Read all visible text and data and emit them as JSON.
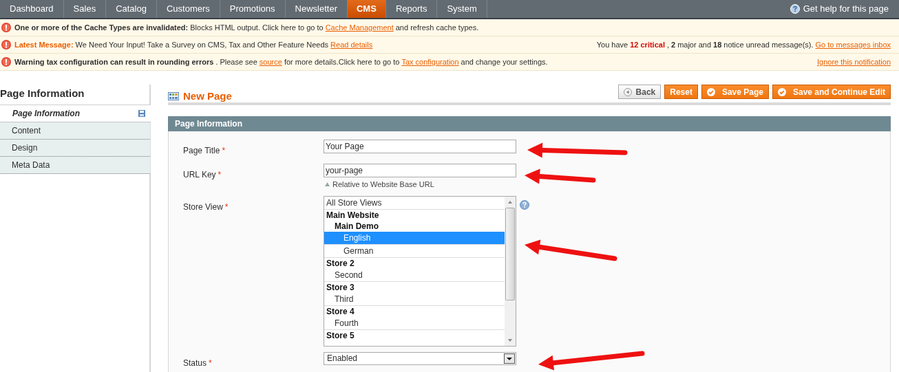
{
  "nav": {
    "items": [
      {
        "label": "Dashboard",
        "selected": false
      },
      {
        "label": "Sales",
        "selected": false
      },
      {
        "label": "Catalog",
        "selected": false
      },
      {
        "label": "Customers",
        "selected": false
      },
      {
        "label": "Promotions",
        "selected": false
      },
      {
        "label": "Newsletter",
        "selected": false
      },
      {
        "label": "CMS",
        "selected": true
      },
      {
        "label": "Reports",
        "selected": false
      },
      {
        "label": "System",
        "selected": false
      }
    ],
    "help": "Get help for this page"
  },
  "messages": [
    {
      "left": [
        {
          "kind": "bold",
          "text": "One or more of the Cache Types are invalidated:"
        },
        {
          "kind": "plain",
          "text": "Blocks HTML output. Click here to go to"
        },
        {
          "kind": "link",
          "text": "Cache Management"
        },
        {
          "kind": "plain",
          "text": "and refresh cache types."
        }
      ]
    },
    {
      "left": [
        {
          "kind": "label",
          "text": "Latest Message:"
        },
        {
          "kind": "plain",
          "text": "We Need Your Input! Take a Survey on CMS, Tax and Other Feature Needs"
        },
        {
          "kind": "link",
          "text": "Read details"
        }
      ],
      "right": [
        {
          "kind": "plain",
          "text": "You have"
        },
        {
          "kind": "critical",
          "text": "12 critical"
        },
        {
          "kind": "plain",
          "text": ", "
        },
        {
          "kind": "bold",
          "text": "2"
        },
        {
          "kind": "plain",
          "text": "major and"
        },
        {
          "kind": "bold",
          "text": "18"
        },
        {
          "kind": "plain",
          "text": "notice unread message(s)."
        },
        {
          "kind": "link",
          "text": "Go to messages inbox"
        }
      ]
    },
    {
      "left": [
        {
          "kind": "bold",
          "text": "Warning tax configuration can result in rounding errors"
        },
        {
          "kind": "plain",
          "text": ". Please see"
        },
        {
          "kind": "link",
          "text": "source"
        },
        {
          "kind": "plain",
          "text": "for more details.Click here to go to"
        },
        {
          "kind": "link",
          "text": "Tax configuration"
        },
        {
          "kind": "plain",
          "text": "and change your settings."
        }
      ],
      "right": [
        {
          "kind": "link",
          "text": "Ignore this notification"
        }
      ]
    }
  ],
  "sidebar": {
    "title": "Page Information",
    "tabs": [
      {
        "label": "Page Information",
        "selected": true
      },
      {
        "label": "Content",
        "selected": false
      },
      {
        "label": "Design",
        "selected": false
      },
      {
        "label": "Meta Data",
        "selected": false
      }
    ]
  },
  "header": {
    "title": "New Page",
    "buttons": [
      {
        "label": "Back",
        "kind": "back"
      },
      {
        "label": "Reset",
        "kind": "plain"
      },
      {
        "label": "Save Page",
        "kind": "check"
      },
      {
        "label": "Save and Continue Edit",
        "kind": "check"
      }
    ]
  },
  "section": {
    "title": "Page Information",
    "fields": [
      {
        "label": "Page Title",
        "required": "*",
        "kind": "text",
        "value": "Your Page"
      },
      {
        "label": "URL Key",
        "required": "*",
        "kind": "text",
        "value": "your-page",
        "note": "Relative to Website Base URL"
      },
      {
        "label": "Store View",
        "required": "*",
        "kind": "multiselect",
        "options": [
          {
            "kind": "option",
            "label": "All Store Views",
            "selected": false
          },
          {
            "kind": "group",
            "label": "Main Website",
            "children": [
              {
                "kind": "group",
                "label": "Main Demo",
                "children": [
                  {
                    "kind": "option",
                    "label": "English",
                    "selected": true
                  },
                  {
                    "kind": "option",
                    "label": "German",
                    "selected": false
                  }
                ]
              }
            ]
          },
          {
            "kind": "group",
            "label": "Store 2",
            "children": [
              {
                "kind": "option",
                "label": "Second",
                "selected": false
              }
            ]
          },
          {
            "kind": "group",
            "label": "Store 3",
            "children": [
              {
                "kind": "option",
                "label": "Third",
                "selected": false
              }
            ]
          },
          {
            "kind": "group",
            "label": "Store 4",
            "children": [
              {
                "kind": "option",
                "label": "Fourth",
                "selected": false
              }
            ]
          },
          {
            "kind": "group",
            "label": "Store 5"
          }
        ]
      },
      {
        "label": "Status",
        "required": "*",
        "kind": "select",
        "value": "Enabled"
      }
    ]
  }
}
